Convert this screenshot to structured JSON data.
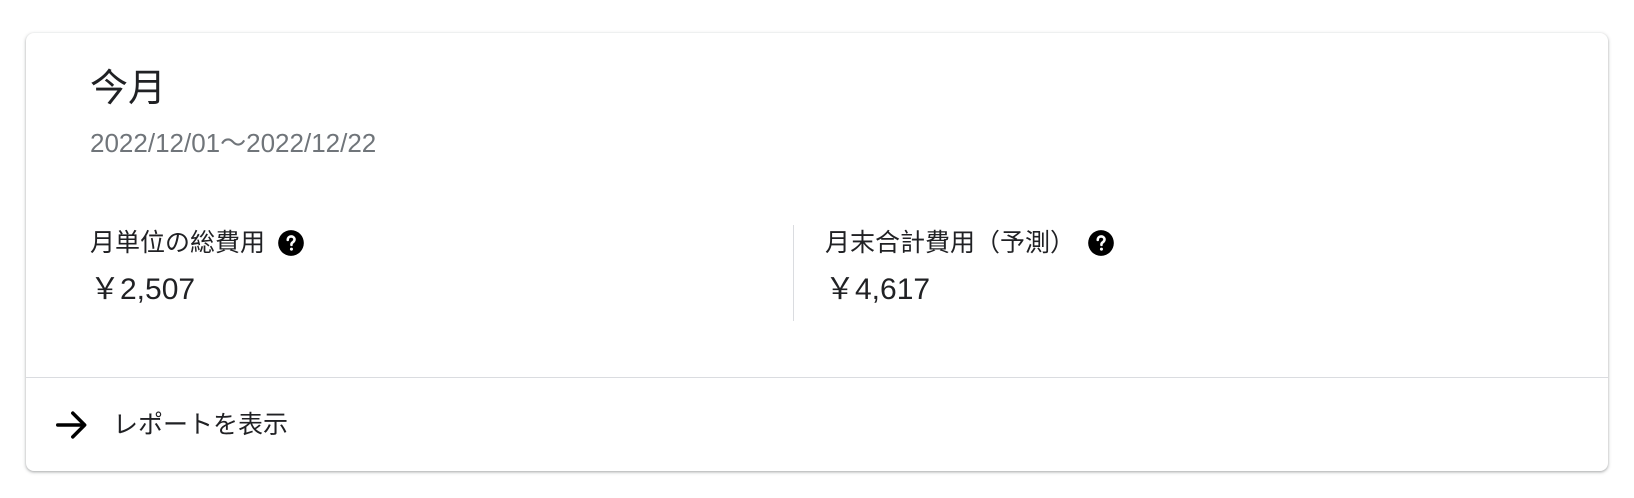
{
  "card": {
    "title": "今月",
    "date_range": "2022/12/01〜2022/12/22"
  },
  "metrics": [
    {
      "label": "月単位の総費用",
      "value": "￥2,507",
      "help_icon": "help-circle-icon"
    },
    {
      "label": "月末合計費用（予測）",
      "value": "￥4,617",
      "help_icon": "help-circle-icon"
    }
  ],
  "footer": {
    "link_label": "レポートを表示",
    "icon": "arrow-right-icon"
  },
  "colors": {
    "text_primary": "#202124",
    "text_secondary": "#70757a",
    "divider": "#dadce0"
  }
}
